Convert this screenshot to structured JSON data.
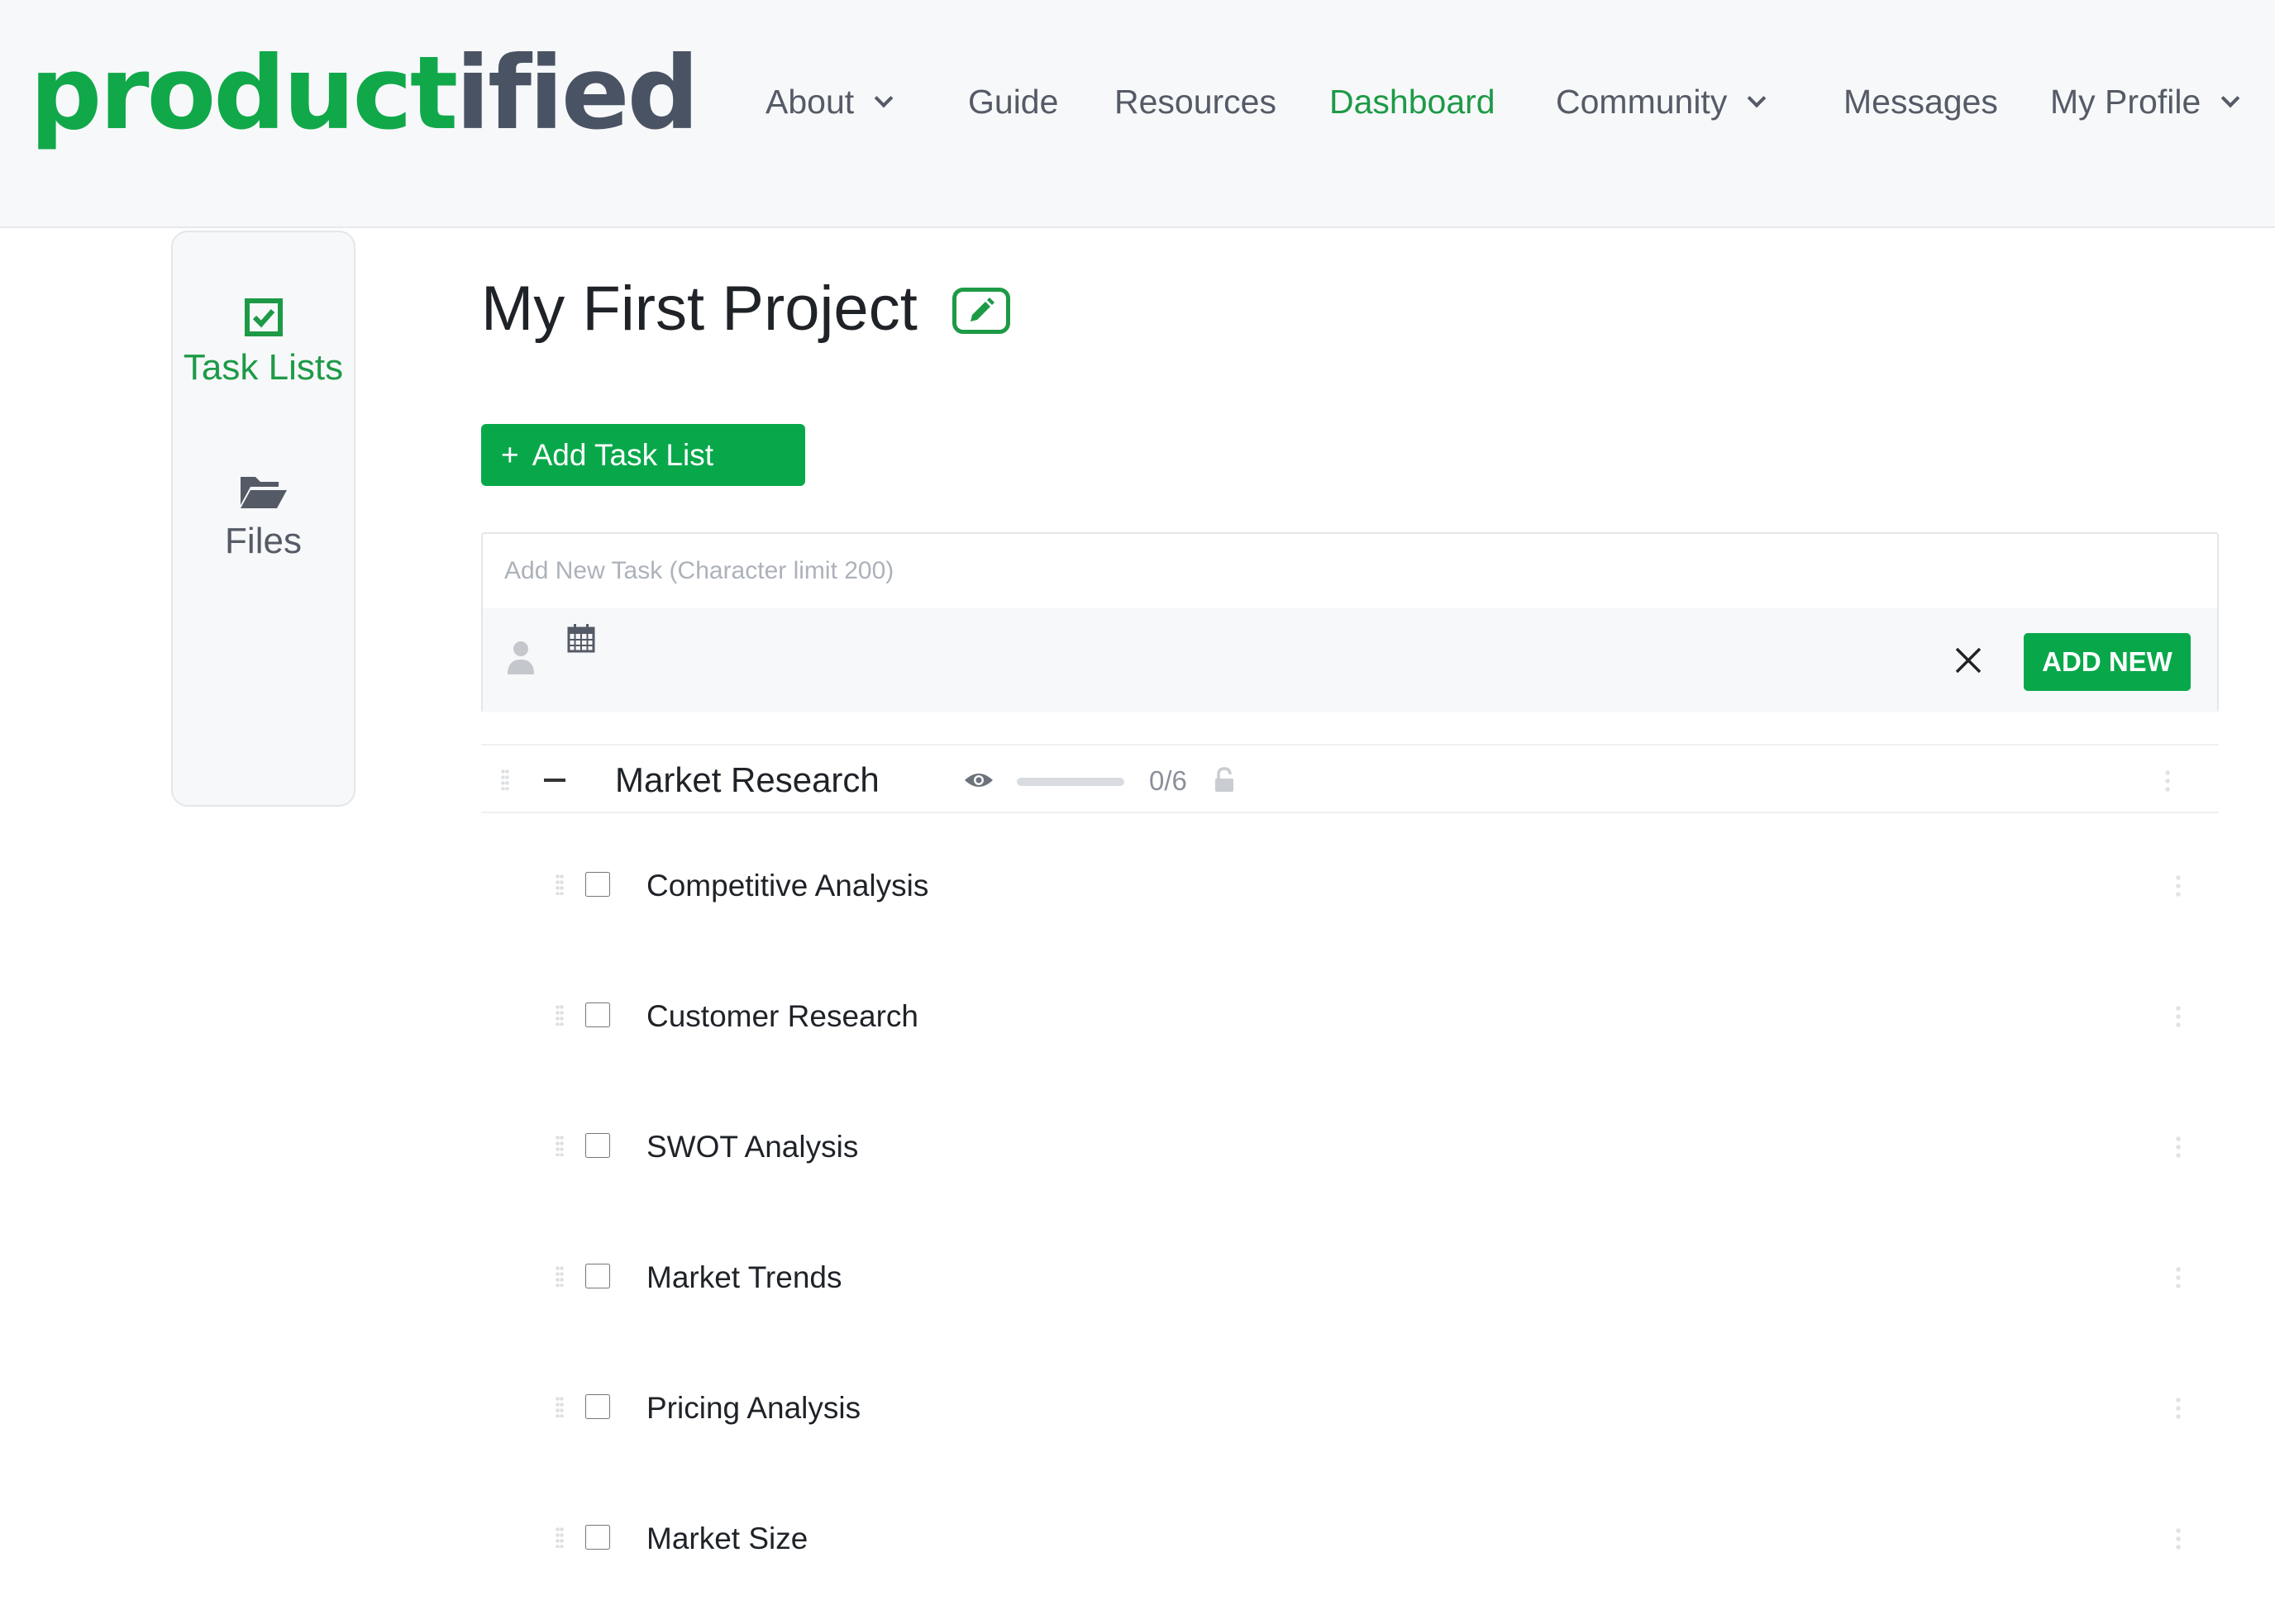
{
  "header": {
    "logo": {
      "part1": "product",
      "part2": "ified",
      "accent_color": "#11a84a",
      "dark_color": "#4a5363"
    },
    "nav": [
      {
        "label": "About",
        "dropdown": true,
        "active": false
      },
      {
        "label": "Guide",
        "dropdown": false,
        "active": false
      },
      {
        "label": "Resources",
        "dropdown": false,
        "active": false
      },
      {
        "label": "Dashboard",
        "dropdown": false,
        "active": true
      },
      {
        "label": "Community",
        "dropdown": true,
        "active": false
      },
      {
        "label": "Messages",
        "dropdown": false,
        "active": false
      },
      {
        "label": "My Profile",
        "dropdown": true,
        "active": false
      }
    ]
  },
  "sidebar": {
    "items": [
      {
        "label": "Task Lists",
        "icon": "checkbox-check-icon",
        "active": true
      },
      {
        "label": "Files",
        "icon": "folder-open-icon",
        "active": false
      }
    ]
  },
  "project": {
    "title": "My First Project",
    "add_task_list_label": "Add Task List",
    "add_task_list_symbol": "+"
  },
  "new_task": {
    "placeholder": "Add New Task (Character limit 200)",
    "add_label": "ADD NEW"
  },
  "task_list": {
    "name": "Market Research",
    "completed": 0,
    "total": 6,
    "count_label": "0/6",
    "progress": 0,
    "tasks": [
      {
        "name": "Competitive Analysis",
        "done": false
      },
      {
        "name": "Customer Research",
        "done": false
      },
      {
        "name": "SWOT Analysis",
        "done": false
      },
      {
        "name": "Market Trends",
        "done": false
      },
      {
        "name": "Pricing Analysis",
        "done": false
      },
      {
        "name": "Market Size",
        "done": false
      }
    ]
  },
  "colors": {
    "primary": "#08a84a",
    "active_text": "#1e9a47",
    "header_bg": "#f7f8fa"
  }
}
